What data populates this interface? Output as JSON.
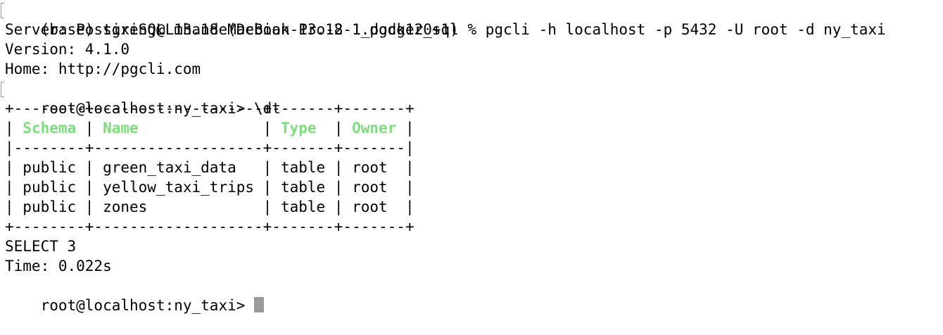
{
  "terminal": {
    "command_line": "(base) sixing@LmhandeMacBook-Pro-2 1_docker_sql % pgcli -h localhost -p 5432 -U root -d ny_taxi",
    "server_line": "Server: PostgreSQL 13.18 (Debian 13.18-1.pgdg120+1)",
    "version_line": "Version: 4.1.0",
    "home_line": "Home: http://pgcli.com",
    "prompt_command": "root@localhost:ny_taxi> \\dt",
    "result_status": "SELECT 3",
    "result_time": "Time: 0.022s",
    "partial_prompt": "root@localhost:ny_taxi>"
  },
  "table": {
    "top_border": "+--------+-------------------+-------+-------+",
    "separator": "|--------+-------------------+-------+-------|",
    "bottom_border": "+--------+-------------------+-------+-------+",
    "headers": [
      "Schema",
      "Name",
      "Type",
      "Owner"
    ],
    "rows": [
      [
        "public",
        "green_taxi_data",
        "table",
        "root"
      ],
      [
        "public",
        "yellow_taxi_trips",
        "table",
        "root"
      ],
      [
        "public",
        "zones",
        "table",
        "root"
      ]
    ]
  },
  "colors": {
    "header_text": "#7be07b",
    "cursor": "#9a9a9a"
  }
}
